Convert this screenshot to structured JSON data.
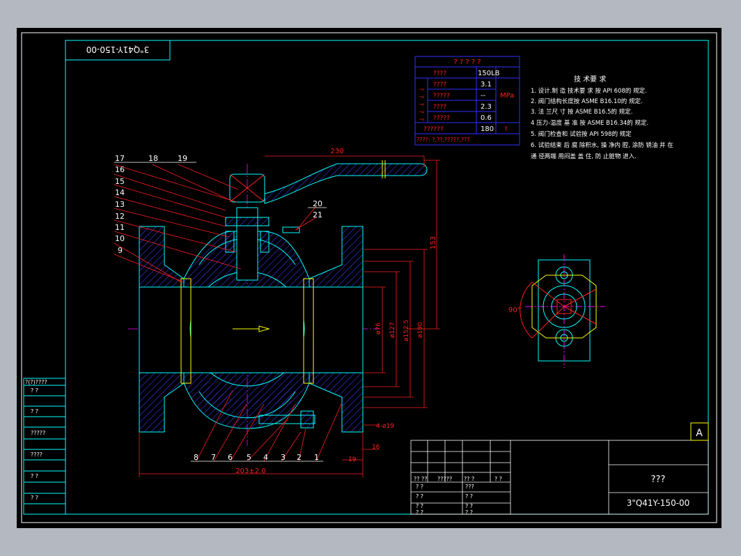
{
  "drawing": {
    "number_top_mirrored": "3\"Q41Y-150-00",
    "number": "3\"Q41Y-150-00",
    "title_placeholder": "???",
    "corner_mark": "A"
  },
  "params_table": {
    "header": "? ? ? ? ?",
    "rows": [
      {
        "label": "????",
        "value": "150LB",
        "unit": ""
      },
      {
        "label": "????",
        "value": "3.1",
        "unit": ""
      },
      {
        "label": "?????",
        "value": "--",
        "unit": "MPa"
      },
      {
        "label": "????",
        "value": "2.3",
        "unit": ""
      },
      {
        "label": "?????",
        "value": "0.6",
        "unit": ""
      },
      {
        "label": "??????",
        "value": "180",
        "unit": "?"
      }
    ],
    "group_label": "? ? ? ? ?",
    "footer": "????:   ?,??,?????,???"
  },
  "tech_requirements": {
    "title": "技 术要 求",
    "items": [
      "1.  设计.制 造 技术要 求 按 API 608的    规定.",
      "2.  阀门结构长度按 ASME  B16.10的     规定.",
      "3.  法 兰尺 寸 按 ASME  B16.5的     规定.",
      "4   压力-温度 基 准 按 ASME  B16.34的      规定.",
      "5.  阀门检查和 试验按 API 598的     规定",
      "6.  试验结束 后 腐 除积水, 操 净内 腔, 涂防 锈油 并 在",
      "       通  径两端  用闷盖 盖 住, 防 止脏物  进入."
    ]
  },
  "part_numbers_left": [
    "17",
    "18",
    "19",
    "16",
    "15",
    "14",
    "13",
    "12",
    "11",
    "10",
    "9"
  ],
  "part_numbers_right": [
    "20",
    "21"
  ],
  "part_numbers_bottom": [
    "8",
    "7",
    "6",
    "5",
    "4",
    "3",
    "2",
    "1"
  ],
  "dimensions": {
    "handle_length": "230",
    "height": "153",
    "d1": "ø76",
    "d2": "ø127",
    "d3": "ø152.5",
    "d4": "ø190",
    "bolts": "4-ø19",
    "flange_t": "16",
    "raised": "19",
    "length": "203±2.0",
    "angle": "90°"
  },
  "left_revision_block": {
    "header": "?(?)????",
    "rows": [
      "?  ?",
      "?  ?",
      "?????",
      "????",
      "?  ?",
      "?  ?"
    ]
  },
  "title_block": {
    "sign_header": [
      "??  ??",
      "?????",
      "??  ?",
      "? ?"
    ],
    "sign_rows": [
      "? ?",
      "? ?",
      "? ?",
      "? ?"
    ],
    "approve_rows": [
      "???",
      "? ?",
      "? ?",
      "? ?"
    ]
  },
  "colors": {
    "frame": "#ffffff",
    "cyan": "#00ffff",
    "red": "#ff2020",
    "blue": "#3030ff",
    "yellow": "#ffff00",
    "magenta": "#ff00ff",
    "white": "#ffffff"
  }
}
